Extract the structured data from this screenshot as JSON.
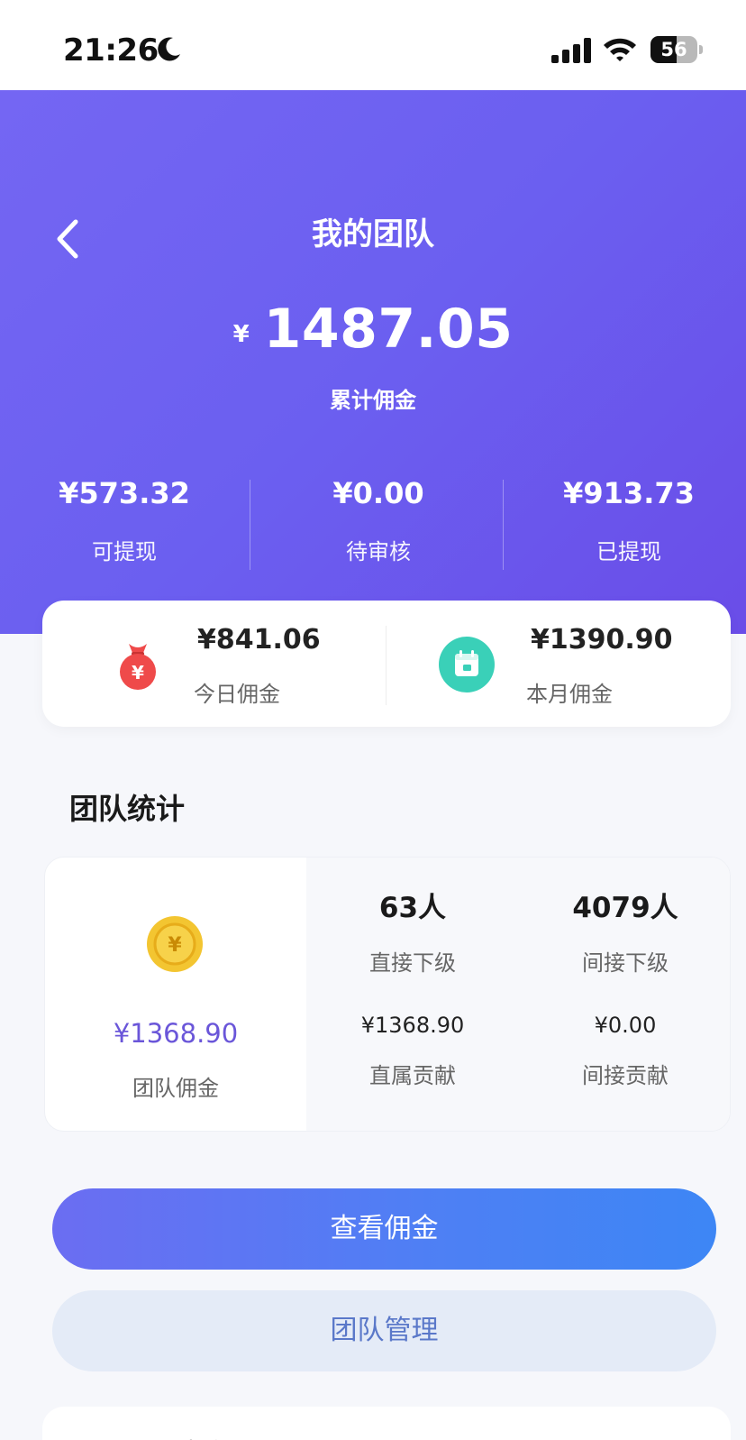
{
  "status_bar": {
    "time": "21:26",
    "battery_level": "56",
    "battery_fraction": 0.56,
    "icons": [
      "moon-icon",
      "signal-icon",
      "wifi-icon",
      "battery-icon"
    ]
  },
  "header": {
    "title": "我的团队",
    "back_icon": "chevron-left-icon",
    "gradient_colors": [
      "#7466f3",
      "#6a4de8"
    ],
    "total": {
      "currency": "¥",
      "amount": "1487.05",
      "label": "累计佣金"
    },
    "stats": [
      {
        "value": "¥573.32",
        "label": "可提现"
      },
      {
        "value": "¥0.00",
        "label": "待审核"
      },
      {
        "value": "¥913.73",
        "label": "已提现"
      }
    ]
  },
  "summary": {
    "today": {
      "value": "¥841.06",
      "label": "今日佣金",
      "icon": "money-bag-icon",
      "color": "#ef4a4a"
    },
    "month": {
      "value": "¥1390.90",
      "label": "本月佣金",
      "icon": "calendar-icon",
      "color": "#3ad0b8"
    }
  },
  "team_stats": {
    "title": "团队统计",
    "team_commission": {
      "value": "¥1368.90",
      "label": "团队佣金",
      "icon": "coin-icon",
      "color": "#6a56d9"
    },
    "direct_members": {
      "value": "63人",
      "label": "直接下级"
    },
    "indirect_members": {
      "value": "4079人",
      "label": "间接下级"
    },
    "direct_contribution": {
      "value": "¥1368.90",
      "label": "直属贡献"
    },
    "indirect_contribution": {
      "value": "¥0.00",
      "label": "间接贡献"
    }
  },
  "actions": {
    "view_commission": "查看佣金",
    "team_management": "团队管理"
  },
  "bottom_section": {
    "title_partial": "分享邀请"
  }
}
